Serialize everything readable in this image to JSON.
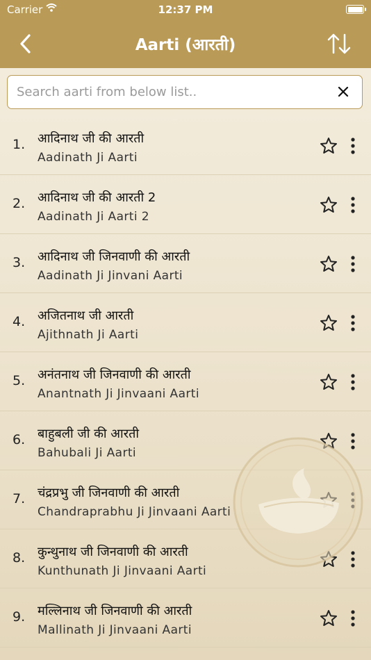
{
  "status_bar": {
    "carrier": "Carrier",
    "time": "12:37 PM"
  },
  "navbar": {
    "title": "Aarti (आरती)",
    "back_icon": "chevron-left-icon",
    "sort_icon": "sort-arrows-icon"
  },
  "search": {
    "placeholder": "Search aarti from below list..",
    "value": "",
    "clear_icon": "close-icon"
  },
  "colors": {
    "header": "#b99a56",
    "background": "#efe6d3",
    "divider": "#dcd0b5"
  },
  "list": [
    {
      "num": "1.",
      "title_hi": "आदिनाथ जी की आरती",
      "title_en": "Aadinath Ji Aarti"
    },
    {
      "num": "2.",
      "title_hi": "आदिनाथ जी की आरती 2",
      "title_en": "Aadinath Ji Aarti 2"
    },
    {
      "num": "3.",
      "title_hi": "आदिनाथ जी जिनवाणी की आरती",
      "title_en": "Aadinath Ji Jinvani Aarti"
    },
    {
      "num": "4.",
      "title_hi": "अजितनाथ जी आरती",
      "title_en": "Ajithnath Ji Aarti"
    },
    {
      "num": "5.",
      "title_hi": "अनंतनाथ जी जिनवाणी की आरती",
      "title_en": "Anantnath Ji Jinvaani Aarti"
    },
    {
      "num": "6.",
      "title_hi": " बाहुबली जी की आरती",
      "title_en": "Bahubali Ji Aarti"
    },
    {
      "num": "7.",
      "title_hi": "चंद्रप्रभु जी जिनवाणी की आरती",
      "title_en": "Chandraprabhu Ji Jinvaani Aarti"
    },
    {
      "num": "8.",
      "title_hi": "कुन्थुनाथ जी जिनवाणी की आरती",
      "title_en": "Kunthunath Ji Jinvaani Aarti"
    },
    {
      "num": "9.",
      "title_hi": "मल्लिनाथ  जी जिनवाणी की आरती",
      "title_en": "Mallinath Ji Jinvaani Aarti"
    }
  ]
}
